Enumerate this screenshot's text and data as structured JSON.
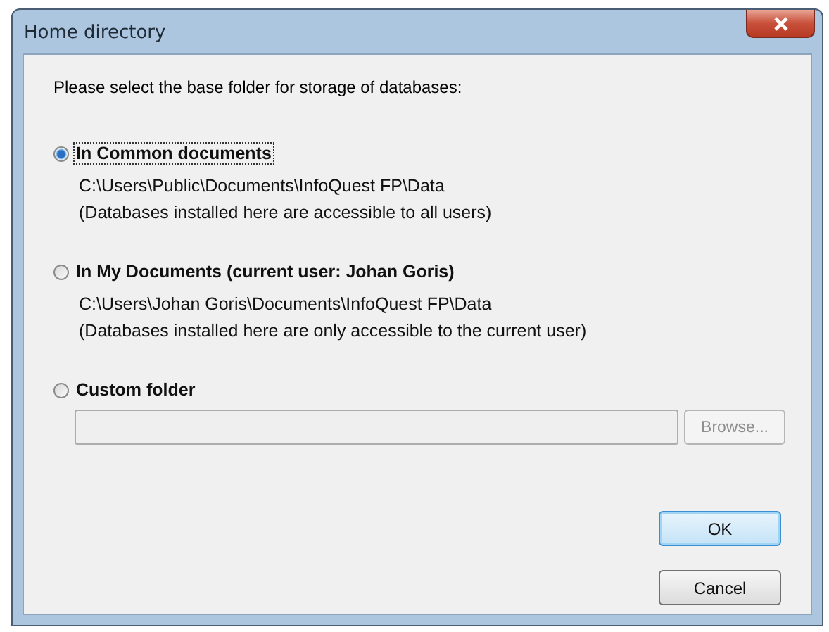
{
  "window": {
    "title": "Home directory"
  },
  "prompt": "Please select the base folder for storage of databases:",
  "options": [
    {
      "label": "In Common documents",
      "selected": true,
      "details": [
        "C:\\Users\\Public\\Documents\\InfoQuest FP\\Data",
        "(Databases installed here are accessible to all users)"
      ]
    },
    {
      "label": "In My Documents (current user: Johan Goris)",
      "selected": false,
      "details": [
        "C:\\Users\\Johan Goris\\Documents\\InfoQuest FP\\Data",
        "(Databases installed here are only accessible to the current user)"
      ]
    },
    {
      "label": "Custom folder",
      "selected": false
    }
  ],
  "custom_folder": {
    "disabled": true,
    "browse": {
      "label": "Browse...",
      "disabled": true
    }
  },
  "buttons": [
    {
      "label": "OK",
      "default": true
    },
    {
      "label": "Cancel",
      "default": false
    }
  ]
}
